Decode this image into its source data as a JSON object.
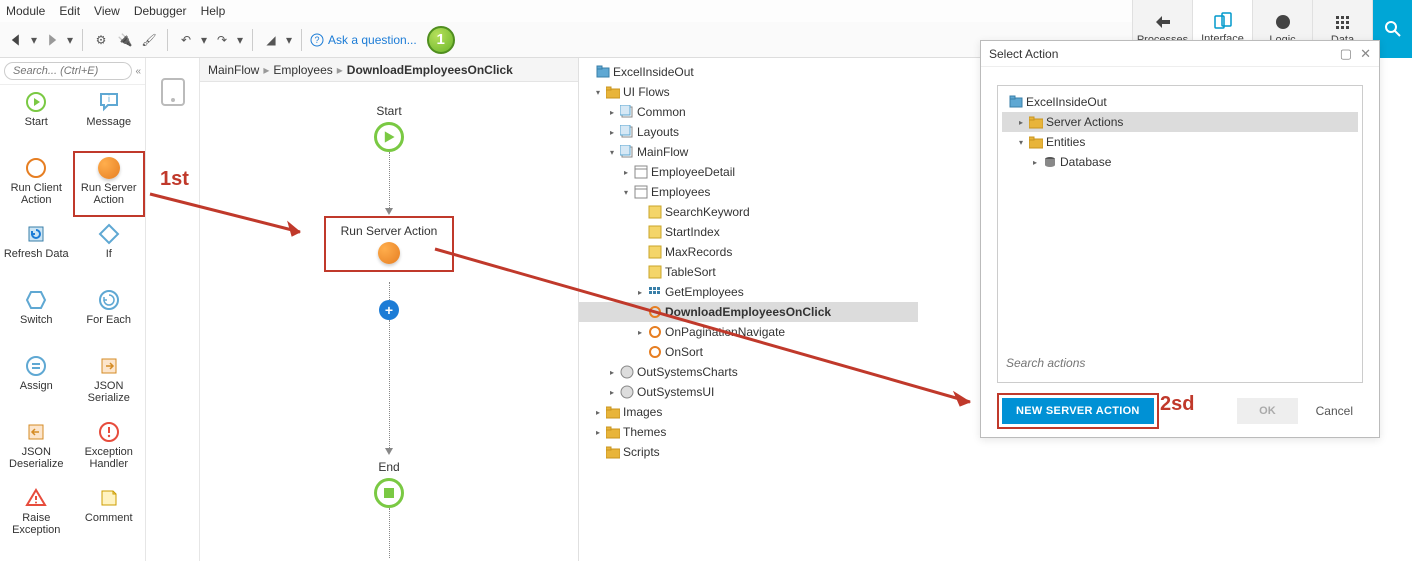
{
  "menu": {
    "module": "Module",
    "edit": "Edit",
    "view": "View",
    "debugger": "Debugger",
    "help": "Help"
  },
  "toolbar": {
    "ask": "Ask a question..."
  },
  "righttabs": {
    "processes": "Processes",
    "interface": "Interface",
    "logic": "Logic",
    "data": "Data"
  },
  "search_placeholder": "Search... (Ctrl+E)",
  "tools": {
    "start": "Start",
    "message": "Message",
    "runclient": "Run Client Action",
    "runserver": "Run Server Action",
    "refresh": "Refresh Data",
    "if_": "If",
    "switch": "Switch",
    "foreach": "For Each",
    "assign": "Assign",
    "jsonser": "JSON Serialize",
    "jsondeser": "JSON Deserialize",
    "exch": "Exception Handler",
    "raise": "Raise Exception",
    "comment": "Comment"
  },
  "breadcrumb": {
    "a": "MainFlow",
    "b": "Employees",
    "c": "DownloadEmployeesOnClick"
  },
  "flow": {
    "start": "Start",
    "rsa": "Run Server Action",
    "end": "End"
  },
  "tree": {
    "root": "ExcelInsideOut",
    "uiflows": "UI Flows",
    "common": "Common",
    "layouts": "Layouts",
    "mainflow": "MainFlow",
    "empdetail": "EmployeeDetail",
    "employees": "Employees",
    "searchkw": "SearchKeyword",
    "startidx": "StartIndex",
    "maxrec": "MaxRecords",
    "tablesort": "TableSort",
    "getemp": "GetEmployees",
    "dl": "DownloadEmployeesOnClick",
    "pagnav": "OnPaginationNavigate",
    "onsort": "OnSort",
    "oscharts": "OutSystemsCharts",
    "osui": "OutSystemsUI",
    "images": "Images",
    "themes": "Themes",
    "scripts": "Scripts"
  },
  "dialog": {
    "title": "Select Action",
    "root": "ExcelInsideOut",
    "serveractions": "Server Actions",
    "entities": "Entities",
    "database": "Database",
    "search_placeholder": "Search actions",
    "newserver": "NEW SERVER ACTION",
    "ok": "OK",
    "cancel": "Cancel"
  },
  "anno": {
    "first": "1st",
    "second": "2sd",
    "badge": "1"
  }
}
